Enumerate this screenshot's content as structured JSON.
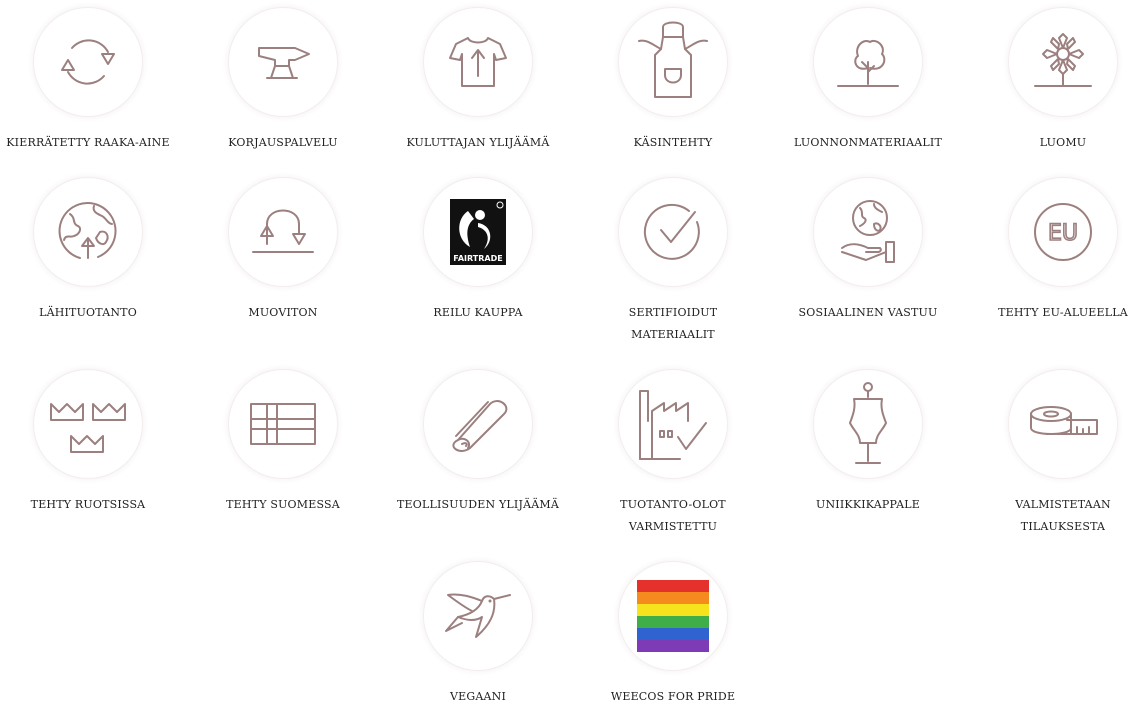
{
  "badges": [
    {
      "label": "KIERRÄTETTY RAAKA-AINE",
      "icon": "recycle-arrows-icon"
    },
    {
      "label": "KORJAUSPALVELU",
      "icon": "anvil-icon"
    },
    {
      "label": "KULUTTAJAN YLIJÄÄMÄ",
      "icon": "tshirt-arrow-icon"
    },
    {
      "label": "KÄSINTEHTY",
      "icon": "apron-icon"
    },
    {
      "label": "LUONNONMATERIAALIT",
      "icon": "tree-icon"
    },
    {
      "label": "LUOMU",
      "icon": "flower-icon"
    },
    {
      "label": "LÄHITUOTANTO",
      "icon": "globe-arrow-icon"
    },
    {
      "label": "MUOVITON",
      "icon": "u-turn-arrows-icon"
    },
    {
      "label": "REILU KAUPPA",
      "icon": "fairtrade-logo-icon"
    },
    {
      "label": "SERTIFIOIDUT\nMATERIAALIT",
      "icon": "check-circle-icon"
    },
    {
      "label": "SOSIAALINEN VASTUU",
      "icon": "hand-globe-icon"
    },
    {
      "label": "TEHTY EU-ALUEELLA",
      "icon": "eu-circle-icon"
    },
    {
      "label": "TEHTY RUOTSISSA",
      "icon": "three-crowns-icon"
    },
    {
      "label": "TEHTY SUOMESSA",
      "icon": "finnish-flag-icon"
    },
    {
      "label": "TEOLLISUUDEN YLIJÄÄMÄ",
      "icon": "fabric-roll-icon"
    },
    {
      "label": "TUOTANTO-OLOT\nVARMISTETTU",
      "icon": "factory-check-icon"
    },
    {
      "label": "UNIIKKIKAPPALE",
      "icon": "dress-form-icon"
    },
    {
      "label": "VALMISTETAAN\nTILAUKSESTA",
      "icon": "measuring-tape-icon"
    },
    {
      "label": "VEGAANI",
      "icon": "hummingbird-icon"
    },
    {
      "label": "WEECOS FOR PRIDE",
      "icon": "pride-flag-icon"
    }
  ],
  "fairtrade_logo_text": "FAIRTRADE",
  "eu_text": "EU",
  "colors": {
    "icon_stroke": "#9c7f7f",
    "label_text": "#222222",
    "pride": [
      "#e4312b",
      "#f58a1f",
      "#f6e21d",
      "#3fae49",
      "#2f63d0",
      "#7d3bb5"
    ]
  }
}
